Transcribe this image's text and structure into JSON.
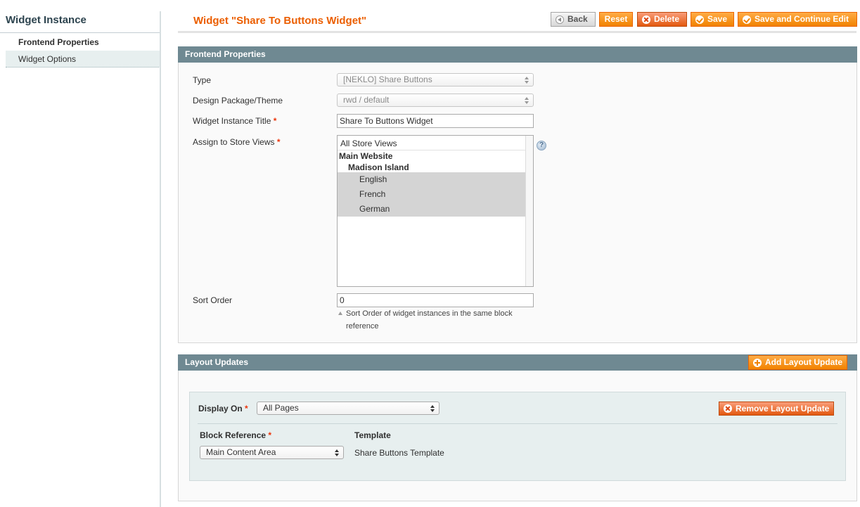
{
  "sidebar": {
    "title": "Widget Instance",
    "items": [
      {
        "label": "Frontend Properties"
      },
      {
        "label": "Widget Options"
      }
    ]
  },
  "header": {
    "title": "Widget \"Share To Buttons Widget\"",
    "buttons": {
      "back": "Back",
      "reset": "Reset",
      "delete": "Delete",
      "save": "Save",
      "save_continue": "Save and Continue Edit"
    }
  },
  "frontend": {
    "heading": "Frontend Properties",
    "type": {
      "label": "Type",
      "value": "[NEKLO] Share Buttons"
    },
    "theme": {
      "label": "Design Package/Theme",
      "value": "rwd / default"
    },
    "title": {
      "label": "Widget Instance Title",
      "required": "*",
      "value": "Share To Buttons Widget"
    },
    "store_views": {
      "label": "Assign to Store Views",
      "required": "*",
      "options": [
        "All Store Views",
        "Main Website",
        "Madison Island",
        "English",
        "French",
        "German"
      ]
    },
    "help_icon": "?",
    "sort_order": {
      "label": "Sort Order",
      "value": "0",
      "note": "Sort Order of widget instances in the same block reference"
    }
  },
  "layout": {
    "heading": "Layout Updates",
    "add_button": "Add Layout Update",
    "display_on": {
      "label": "Display On",
      "required": "*",
      "value": "All Pages"
    },
    "remove_button": "Remove Layout Update",
    "block_reference": {
      "label": "Block Reference",
      "required": "*",
      "value": "Main Content Area"
    },
    "template": {
      "label": "Template",
      "value": "Share Buttons Template"
    }
  },
  "colors": {
    "accent": "#eb5e00",
    "button": "#f18200",
    "section_header": "#6f8992"
  }
}
